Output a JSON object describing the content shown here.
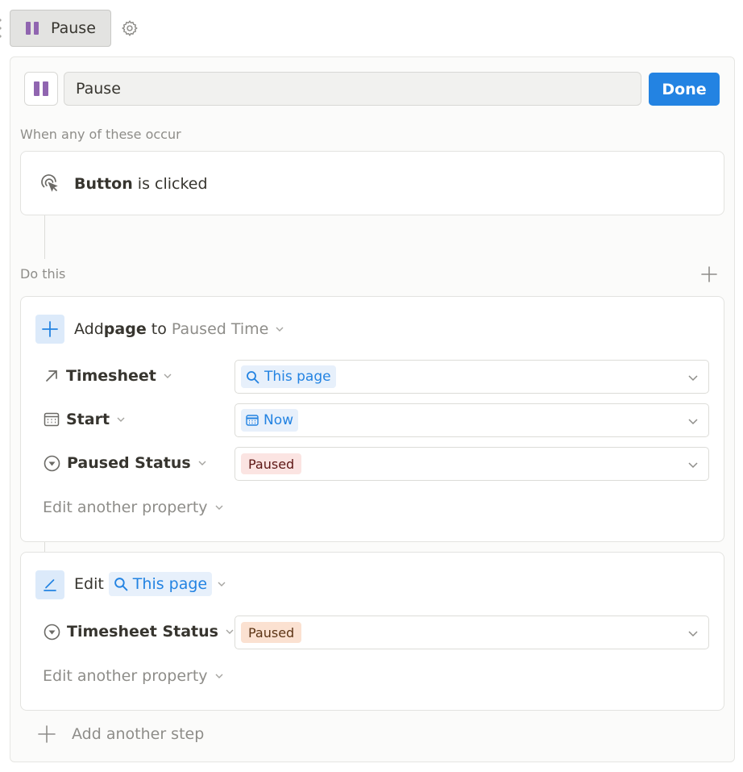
{
  "button_chip": {
    "label": "Pause"
  },
  "editor": {
    "name_value": "Pause",
    "done_label": "Done"
  },
  "trigger": {
    "section_label": "When any of these occur",
    "subject": "Button",
    "predicate": " is clicked"
  },
  "actions": {
    "section_label": "Do this",
    "add_page": {
      "verb": "Add ",
      "object": "page",
      "preposition": " to ",
      "database": "Paused Time",
      "properties": [
        {
          "name": "Timesheet",
          "icon": "relation-arrow-icon",
          "value": "This page",
          "value_icon": "search-icon"
        },
        {
          "name": "Start",
          "icon": "calendar-icon",
          "value": "Now",
          "value_icon": "calendar-icon"
        },
        {
          "name": "Paused Status",
          "icon": "status-icon",
          "value": "Paused"
        }
      ],
      "edit_another": "Edit another property"
    },
    "edit_page": {
      "verb": "Edit",
      "target": "This page",
      "properties": [
        {
          "name": "Timesheet Status",
          "icon": "status-icon",
          "value": "Paused"
        }
      ],
      "edit_another": "Edit another property"
    },
    "add_step": "Add another step"
  },
  "colors": {
    "accent": "#2383e2",
    "pause_icon": "#9065b0",
    "paused_red_bg": "#fbe4e2",
    "paused_orange_bg": "#fbe1d1"
  }
}
